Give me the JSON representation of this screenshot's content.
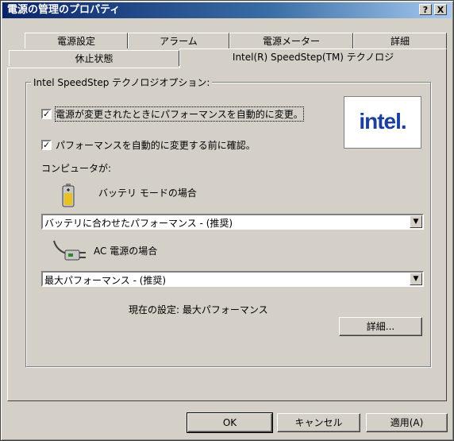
{
  "window": {
    "title": "電源の管理のプロパティ",
    "help_btn": "?",
    "close_btn": "X"
  },
  "tabs": {
    "row1": [
      "電源設定",
      "アラーム",
      "電源メーター",
      "詳細"
    ],
    "row2": [
      "休止状態",
      "Intel(R) SpeedStep(TM) テクノロジ"
    ]
  },
  "group": {
    "label": "Intel SpeedStep テクノロジオプション:"
  },
  "options": {
    "auto_change": {
      "label": "電源が変更されたときにパフォーマンスを自動的に変更。",
      "checked": true
    },
    "confirm": {
      "label": "パフォーマンスを自動的に変更する前に確認。",
      "checked": true
    }
  },
  "logo_text": "intel.",
  "computer_label": "コンピュータが:",
  "battery": {
    "label": "バッテリ モードの場合",
    "selected": "バッテリに合わせたパフォーマンス - (推奨)"
  },
  "ac": {
    "label": "AC 電源の場合",
    "selected": "最大パフォーマンス - (推奨)"
  },
  "status": "現在の設定: 最大パフォーマンス",
  "buttons": {
    "details": "詳細...",
    "ok": "OK",
    "cancel": "キャンセル",
    "apply": "適用(A)"
  },
  "icons": {
    "battery": "battery-icon",
    "ac": "ac-plug-icon",
    "dropdown": "chevron-down-icon"
  }
}
